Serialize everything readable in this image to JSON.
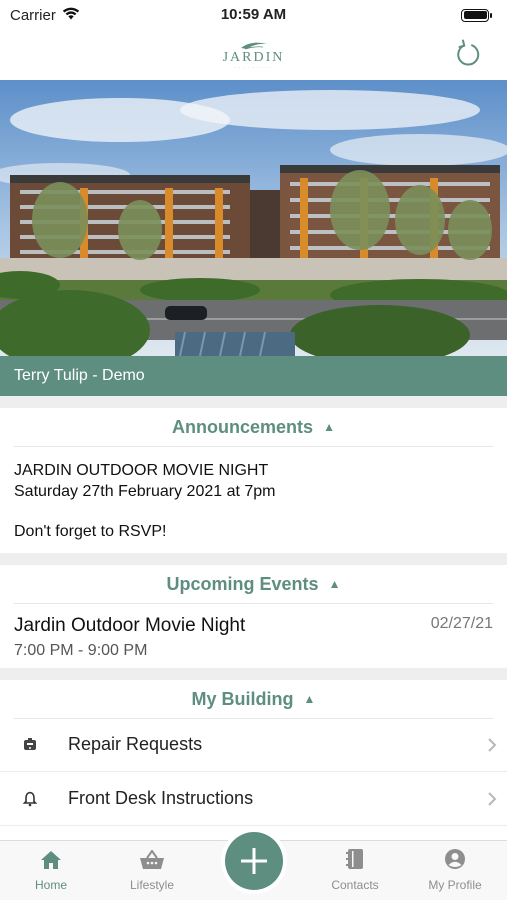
{
  "status_bar": {
    "carrier": "Carrier",
    "time": "10:59 AM"
  },
  "header": {
    "logo_text": "JARDIN",
    "logo_icon": "leaf-icon",
    "refresh_icon": "refresh-icon"
  },
  "resident": {
    "name": "Terry Tulip - Demo"
  },
  "announcements": {
    "title": "Announcements",
    "lines": [
      "JARDIN OUTDOOR MOVIE NIGHT",
      "Saturday 27th February 2021 at 7pm",
      "",
      "Don't forget to RSVP!"
    ]
  },
  "upcoming_events": {
    "title": "Upcoming Events",
    "items": [
      {
        "title": "Jardin Outdoor Movie Night",
        "time": "7:00 PM - 9:00 PM",
        "date": "02/27/21"
      }
    ]
  },
  "my_building": {
    "title": "My Building",
    "items": [
      {
        "label": "Repair Requests",
        "icon": "repair-icon"
      },
      {
        "label": "Front Desk Instructions",
        "icon": "bell-icon"
      }
    ]
  },
  "tab_bar": {
    "items": [
      {
        "label": "Home",
        "icon": "home-icon",
        "active": true
      },
      {
        "label": "Lifestyle",
        "icon": "basket-icon",
        "active": false
      },
      {
        "label": "",
        "icon": "plus-icon",
        "active": false
      },
      {
        "label": "Contacts",
        "icon": "contacts-icon",
        "active": false
      },
      {
        "label": "My Profile",
        "icon": "profile-icon",
        "active": false
      }
    ]
  },
  "colors": {
    "accent": "#5e8e80",
    "section_gap": "#eeeeee"
  }
}
